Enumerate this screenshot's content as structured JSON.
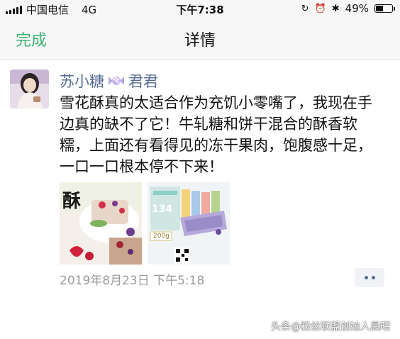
{
  "status_bar": {
    "carrier": "中国电信",
    "network": "4G",
    "time": "下午7:38",
    "battery": "49%",
    "battery_level": 0.49
  },
  "nav": {
    "done_label": "完成",
    "title": "详情"
  },
  "post": {
    "user_name_part1": "苏小糖",
    "user_name_part2": "君君",
    "text": "雪花酥真的太适合作为充饥小零嘴了，我现在手边真的缺不了它！牛轧糖和饼干混合的酥香软糯，上面还有看得见的冻干果肉，饱腹感十足，一口一口根本停不下来！",
    "photo1_caption": "酥",
    "photo2_price": "134",
    "photo2_badge": "200g",
    "timestamp": "2019年8月23日 下午5:18"
  },
  "watermark": "头条@粉丝联盟创始人晨昭"
}
